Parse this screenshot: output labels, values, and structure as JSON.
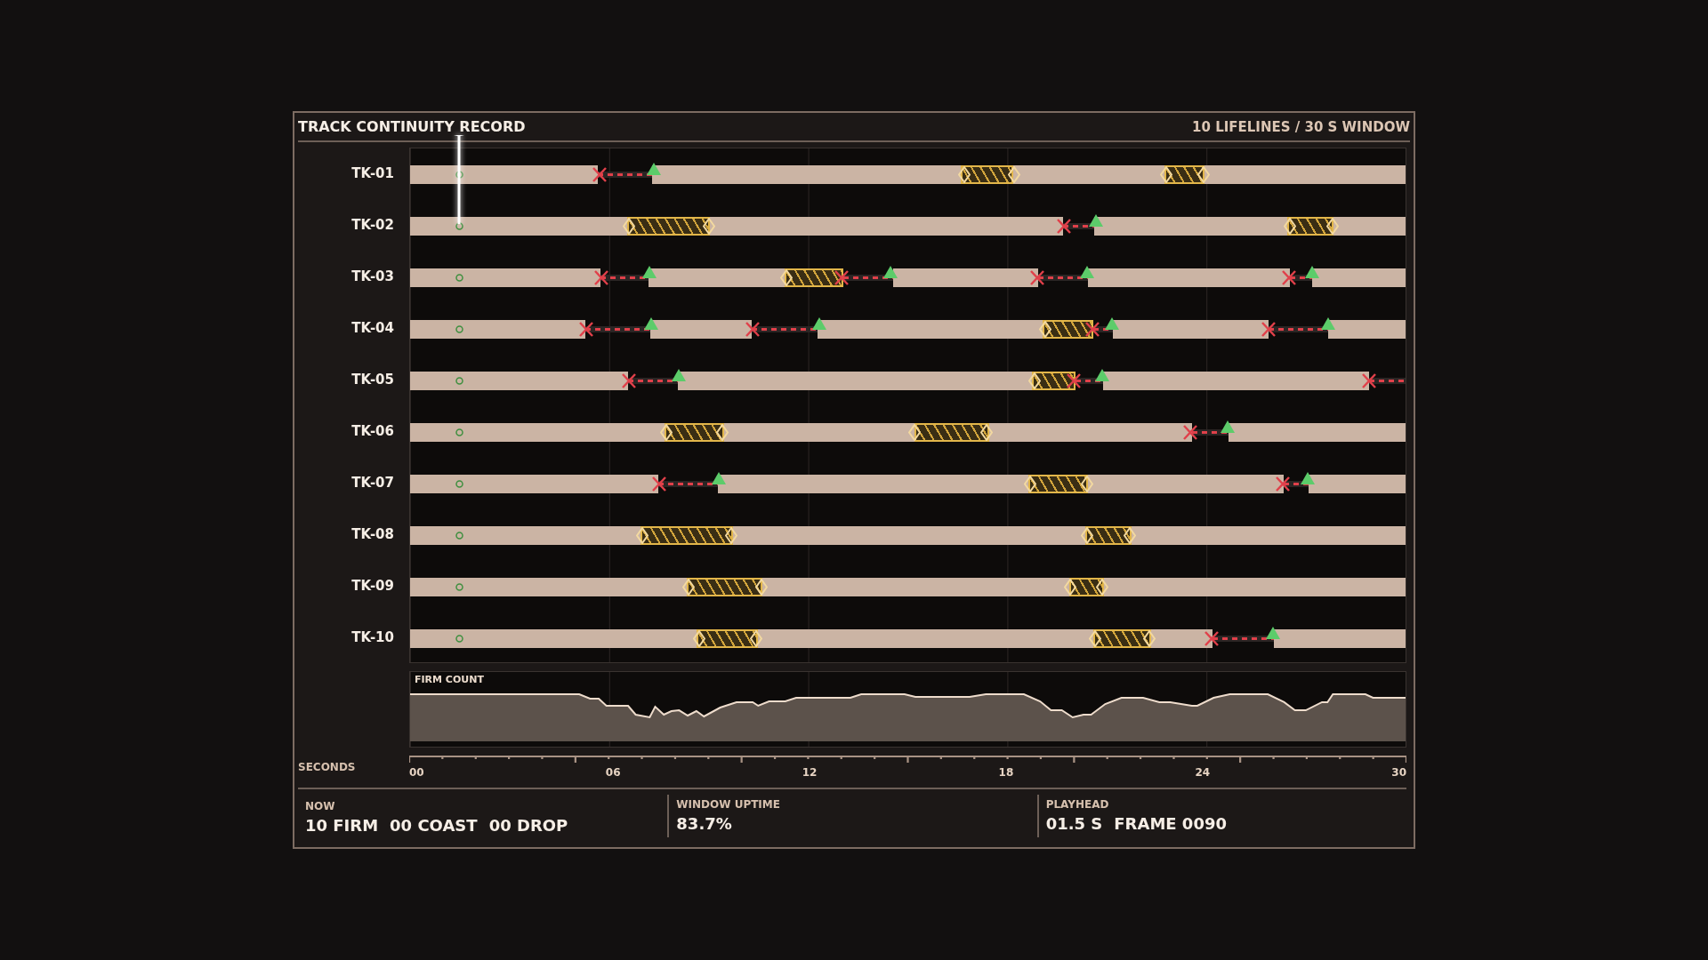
{
  "header": {
    "title": "TRACK CONTINUITY RECORD",
    "summary": "10 LIFELINES / 30 S WINDOW"
  },
  "playhead": {
    "level": 0.05
  },
  "lanes": [
    {
      "label": "TK-01",
      "events": [
        {
          "kind": "drop",
          "level": 0.19
        },
        {
          "kind": "reacquire",
          "level": 0.245
        },
        {
          "kind": "coast_start",
          "level": 0.557
        },
        {
          "kind": "coast_end",
          "level": 0.607
        },
        {
          "kind": "coast_start",
          "level": 0.76
        },
        {
          "kind": "coast_end",
          "level": 0.797
        }
      ]
    },
    {
      "label": "TK-02",
      "events": [
        {
          "kind": "coast_start",
          "level": 0.22
        },
        {
          "kind": "coast_end",
          "level": 0.3
        },
        {
          "kind": "drop",
          "level": 0.657
        },
        {
          "kind": "reacquire",
          "level": 0.689
        },
        {
          "kind": "coast_start",
          "level": 0.884
        },
        {
          "kind": "coast_end",
          "level": 0.927
        }
      ]
    },
    {
      "label": "TK-03",
      "events": [
        {
          "kind": "drop",
          "level": 0.192
        },
        {
          "kind": "reacquire",
          "level": 0.24
        },
        {
          "kind": "coast_start",
          "level": 0.378
        },
        {
          "kind": "drop",
          "level": 0.433
        },
        {
          "kind": "reacquire",
          "level": 0.483
        },
        {
          "kind": "drop",
          "level": 0.63
        },
        {
          "kind": "reacquire",
          "level": 0.68
        },
        {
          "kind": "drop",
          "level": 0.883
        },
        {
          "kind": "reacquire",
          "level": 0.906
        }
      ]
    },
    {
      "label": "TK-04",
      "events": [
        {
          "kind": "drop",
          "level": 0.177
        },
        {
          "kind": "reacquire",
          "level": 0.242
        },
        {
          "kind": "drop",
          "level": 0.344
        },
        {
          "kind": "reacquire",
          "level": 0.411
        },
        {
          "kind": "coast_start",
          "level": 0.638
        },
        {
          "kind": "drop",
          "level": 0.685
        },
        {
          "kind": "reacquire",
          "level": 0.705
        },
        {
          "kind": "drop",
          "level": 0.862
        },
        {
          "kind": "reacquire",
          "level": 0.922
        }
      ]
    },
    {
      "label": "TK-05",
      "events": [
        {
          "kind": "drop",
          "level": 0.22
        },
        {
          "kind": "reacquire",
          "level": 0.27
        },
        {
          "kind": "coast_start",
          "level": 0.627
        },
        {
          "kind": "drop",
          "level": 0.667
        },
        {
          "kind": "reacquire",
          "level": 0.695
        },
        {
          "kind": "drop",
          "level": 0.963
        }
      ]
    },
    {
      "label": "TK-06",
      "events": [
        {
          "kind": "coast_start",
          "level": 0.257
        },
        {
          "kind": "coast_end",
          "level": 0.314
        },
        {
          "kind": "coast_start",
          "level": 0.507
        },
        {
          "kind": "coast_end",
          "level": 0.579
        },
        {
          "kind": "drop",
          "level": 0.784
        },
        {
          "kind": "reacquire",
          "level": 0.821
        }
      ]
    },
    {
      "label": "TK-07",
      "events": [
        {
          "kind": "drop",
          "level": 0.25
        },
        {
          "kind": "reacquire",
          "level": 0.31
        },
        {
          "kind": "coast_start",
          "level": 0.623
        },
        {
          "kind": "coast_end",
          "level": 0.68
        },
        {
          "kind": "drop",
          "level": 0.877
        },
        {
          "kind": "reacquire",
          "level": 0.902
        }
      ]
    },
    {
      "label": "TK-08",
      "events": [
        {
          "kind": "coast_start",
          "level": 0.233
        },
        {
          "kind": "coast_end",
          "level": 0.323
        },
        {
          "kind": "coast_start",
          "level": 0.68
        },
        {
          "kind": "coast_end",
          "level": 0.723
        }
      ]
    },
    {
      "label": "TK-09",
      "events": [
        {
          "kind": "coast_start",
          "level": 0.28
        },
        {
          "kind": "coast_end",
          "level": 0.353
        },
        {
          "kind": "coast_start",
          "level": 0.663
        },
        {
          "kind": "coast_end",
          "level": 0.695
        }
      ]
    },
    {
      "label": "TK-10",
      "events": [
        {
          "kind": "coast_start",
          "level": 0.29
        },
        {
          "kind": "coast_end",
          "level": 0.348
        },
        {
          "kind": "coast_start",
          "level": 0.688
        },
        {
          "kind": "coast_end",
          "level": 0.743
        },
        {
          "kind": "drop",
          "level": 0.805
        },
        {
          "kind": "reacquire",
          "level": 0.867
        }
      ]
    }
  ],
  "firm_count": {
    "title": "FIRM COUNT"
  },
  "axis": {
    "title": "SECONDS",
    "ticks": [
      "00",
      "06",
      "12",
      "18",
      "24",
      "30"
    ]
  },
  "footer": [
    {
      "label": "NOW",
      "values": [
        "10 FIRM",
        "00 COAST",
        "00 DROP"
      ]
    },
    {
      "label": "WINDOW UPTIME",
      "values": [
        "83.7%"
      ]
    },
    {
      "label": "PLAYHEAD",
      "values": [
        "01.5 S",
        "FRAME 0090"
      ]
    }
  ]
}
